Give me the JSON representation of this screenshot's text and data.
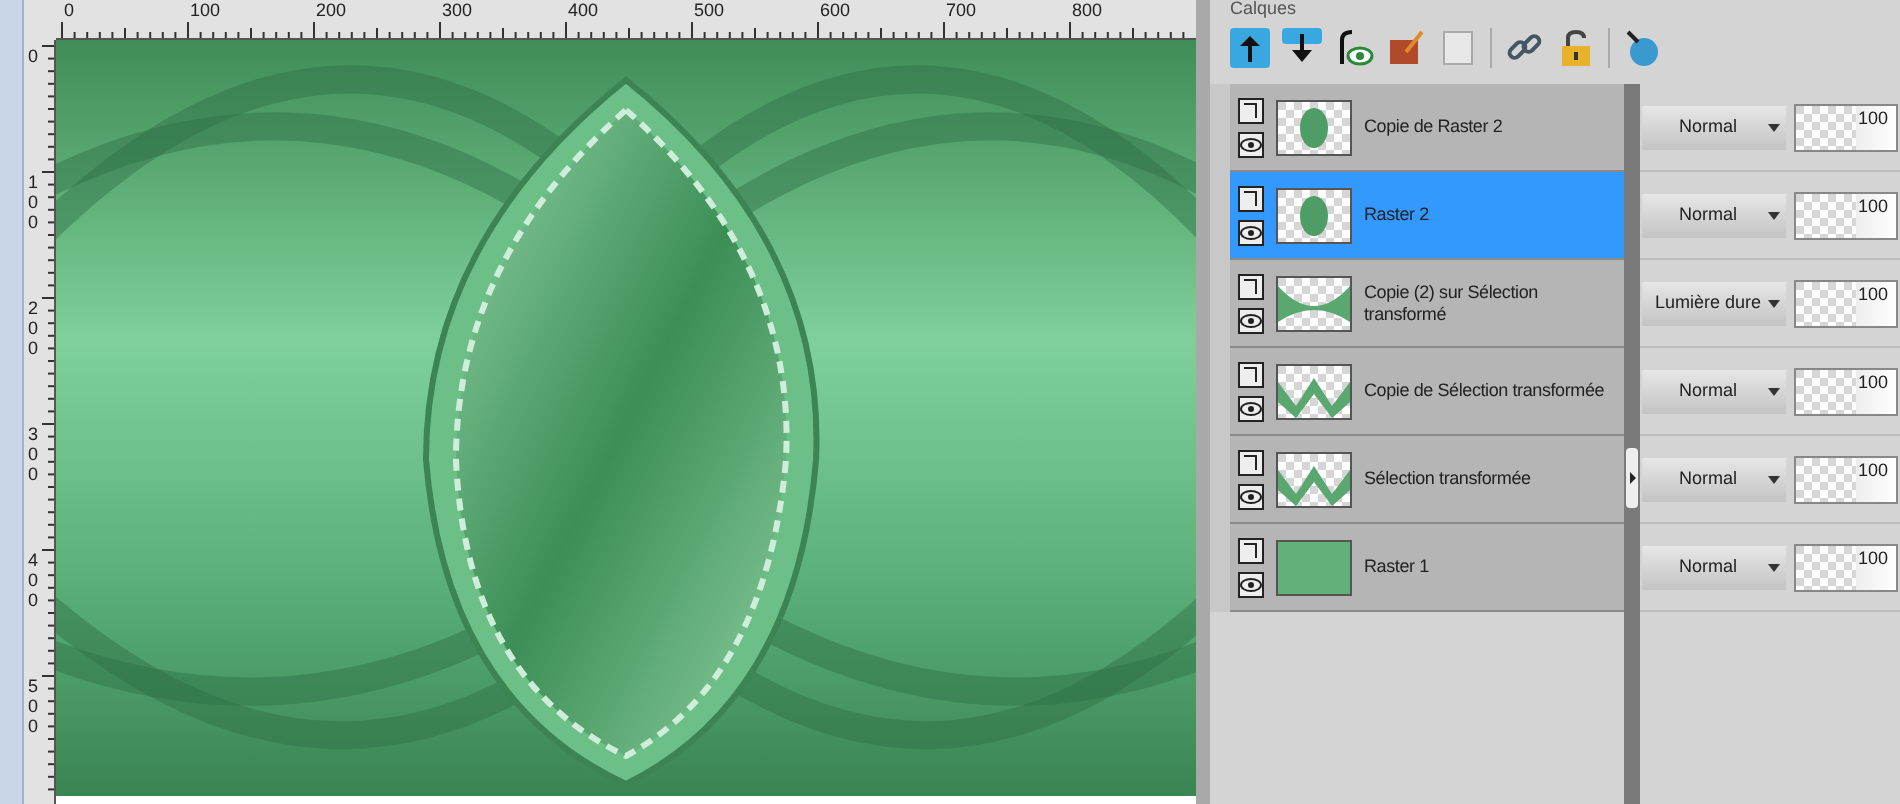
{
  "rulers": {
    "horizontal": [
      "0",
      "100",
      "200",
      "300",
      "400",
      "500",
      "600",
      "700",
      "800"
    ],
    "vertical": [
      "0",
      "100",
      "200",
      "300",
      "400",
      "500"
    ]
  },
  "palette": {
    "title": "Calques",
    "layers": [
      {
        "name": "Copie de Raster 2",
        "selected": false,
        "kind": "leaf",
        "blend_mode": "Normal",
        "opacity": "100"
      },
      {
        "name": "Raster 2",
        "selected": true,
        "kind": "leaf",
        "blend_mode": "Normal",
        "opacity": "100"
      },
      {
        "name": "Copie (2) sur Sélection transformé",
        "selected": false,
        "kind": "band",
        "blend_mode": "Lumière dure",
        "opacity": "100"
      },
      {
        "name": "Copie de Sélection transformée",
        "selected": false,
        "kind": "wave",
        "blend_mode": "Normal",
        "opacity": "100"
      },
      {
        "name": "Sélection transformée",
        "selected": false,
        "kind": "wave",
        "blend_mode": "Normal",
        "opacity": "100"
      },
      {
        "name": "Raster 1",
        "selected": false,
        "kind": "full",
        "blend_mode": "Normal",
        "opacity": "100"
      }
    ]
  }
}
